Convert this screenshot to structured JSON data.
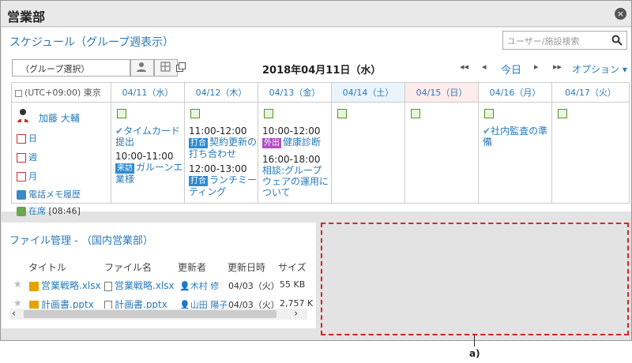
{
  "window": {
    "title": "営業部",
    "close_glyph": "×"
  },
  "schedule": {
    "title": "スケジュール（グループ週表示）",
    "search_placeholder": "ユーザー/施設検索",
    "group_select": "（グループ選択）",
    "date_heading": "2018年04月11日（水）",
    "today_label": "今日",
    "option_label": "オプション ▾",
    "nav": {
      "prev_week": "◂◂",
      "prev_day": "◂",
      "next_day": "▸",
      "next_week": "▸▸"
    },
    "timezone": "(UTC+09:00) 東京",
    "days": [
      {
        "label": "04/11（水）"
      },
      {
        "label": "04/12（木）"
      },
      {
        "label": "04/13（金）"
      },
      {
        "label": "04/14（土）"
      },
      {
        "label": "04/15（日）"
      },
      {
        "label": "04/16（月）"
      },
      {
        "label": "04/17（火）"
      }
    ],
    "user": {
      "name": "加藤 大輔",
      "links": {
        "day": "日",
        "week": "週",
        "month": "月",
        "phone_memo": "電話メモ履歴",
        "presence": "在席",
        "presence_time": "[08:46]"
      }
    },
    "events": {
      "d0_1_title": "タイムカード提出",
      "d0_2_time": "10:00-11:00",
      "d0_2_tag": "来訪",
      "d0_2_title": "ガルーンエ業様",
      "d1_1_time": "11:00-12:00",
      "d1_1_tag": "打合",
      "d1_1_title": "契約更新の打ち合わせ",
      "d1_2_time": "12:00-13:00",
      "d1_2_tag": "打合",
      "d1_2_title": "ランチミーティング",
      "d2_1_time": "10:00-12:00",
      "d2_1_tag": "外出",
      "d2_1_title": "健康診断",
      "d2_2_time": "16:00-18:00",
      "d2_2_title": "相談:グループウェアの運用について",
      "d5_1_title": "社内監査の準備"
    }
  },
  "files": {
    "title": "ファイル管理 - （国内営業部）",
    "headers": [
      "タイトル",
      "ファイル名",
      "更新者",
      "更新日時",
      "サイズ"
    ],
    "rows": [
      {
        "title": "営業戦略.xlsx",
        "filename": "営業戦略.xlsx",
        "updater": "木村 修",
        "date": "04/03（火）",
        "size": "55 KB"
      },
      {
        "title": "計画書.pptx",
        "filename": "計画書.pptx",
        "updater": "山田 陽子",
        "date": "04/03（火）",
        "size": "2,757 K"
      }
    ],
    "scroll_left": "‹",
    "scroll_right": "›"
  },
  "callout": "a)",
  "colors": {
    "accent": "#2a7ab8",
    "dash": "#e02020",
    "tag_meeting": "#2f8ad0",
    "tag_visit": "#2f8ad0",
    "tag_out": "#b04fc7"
  }
}
